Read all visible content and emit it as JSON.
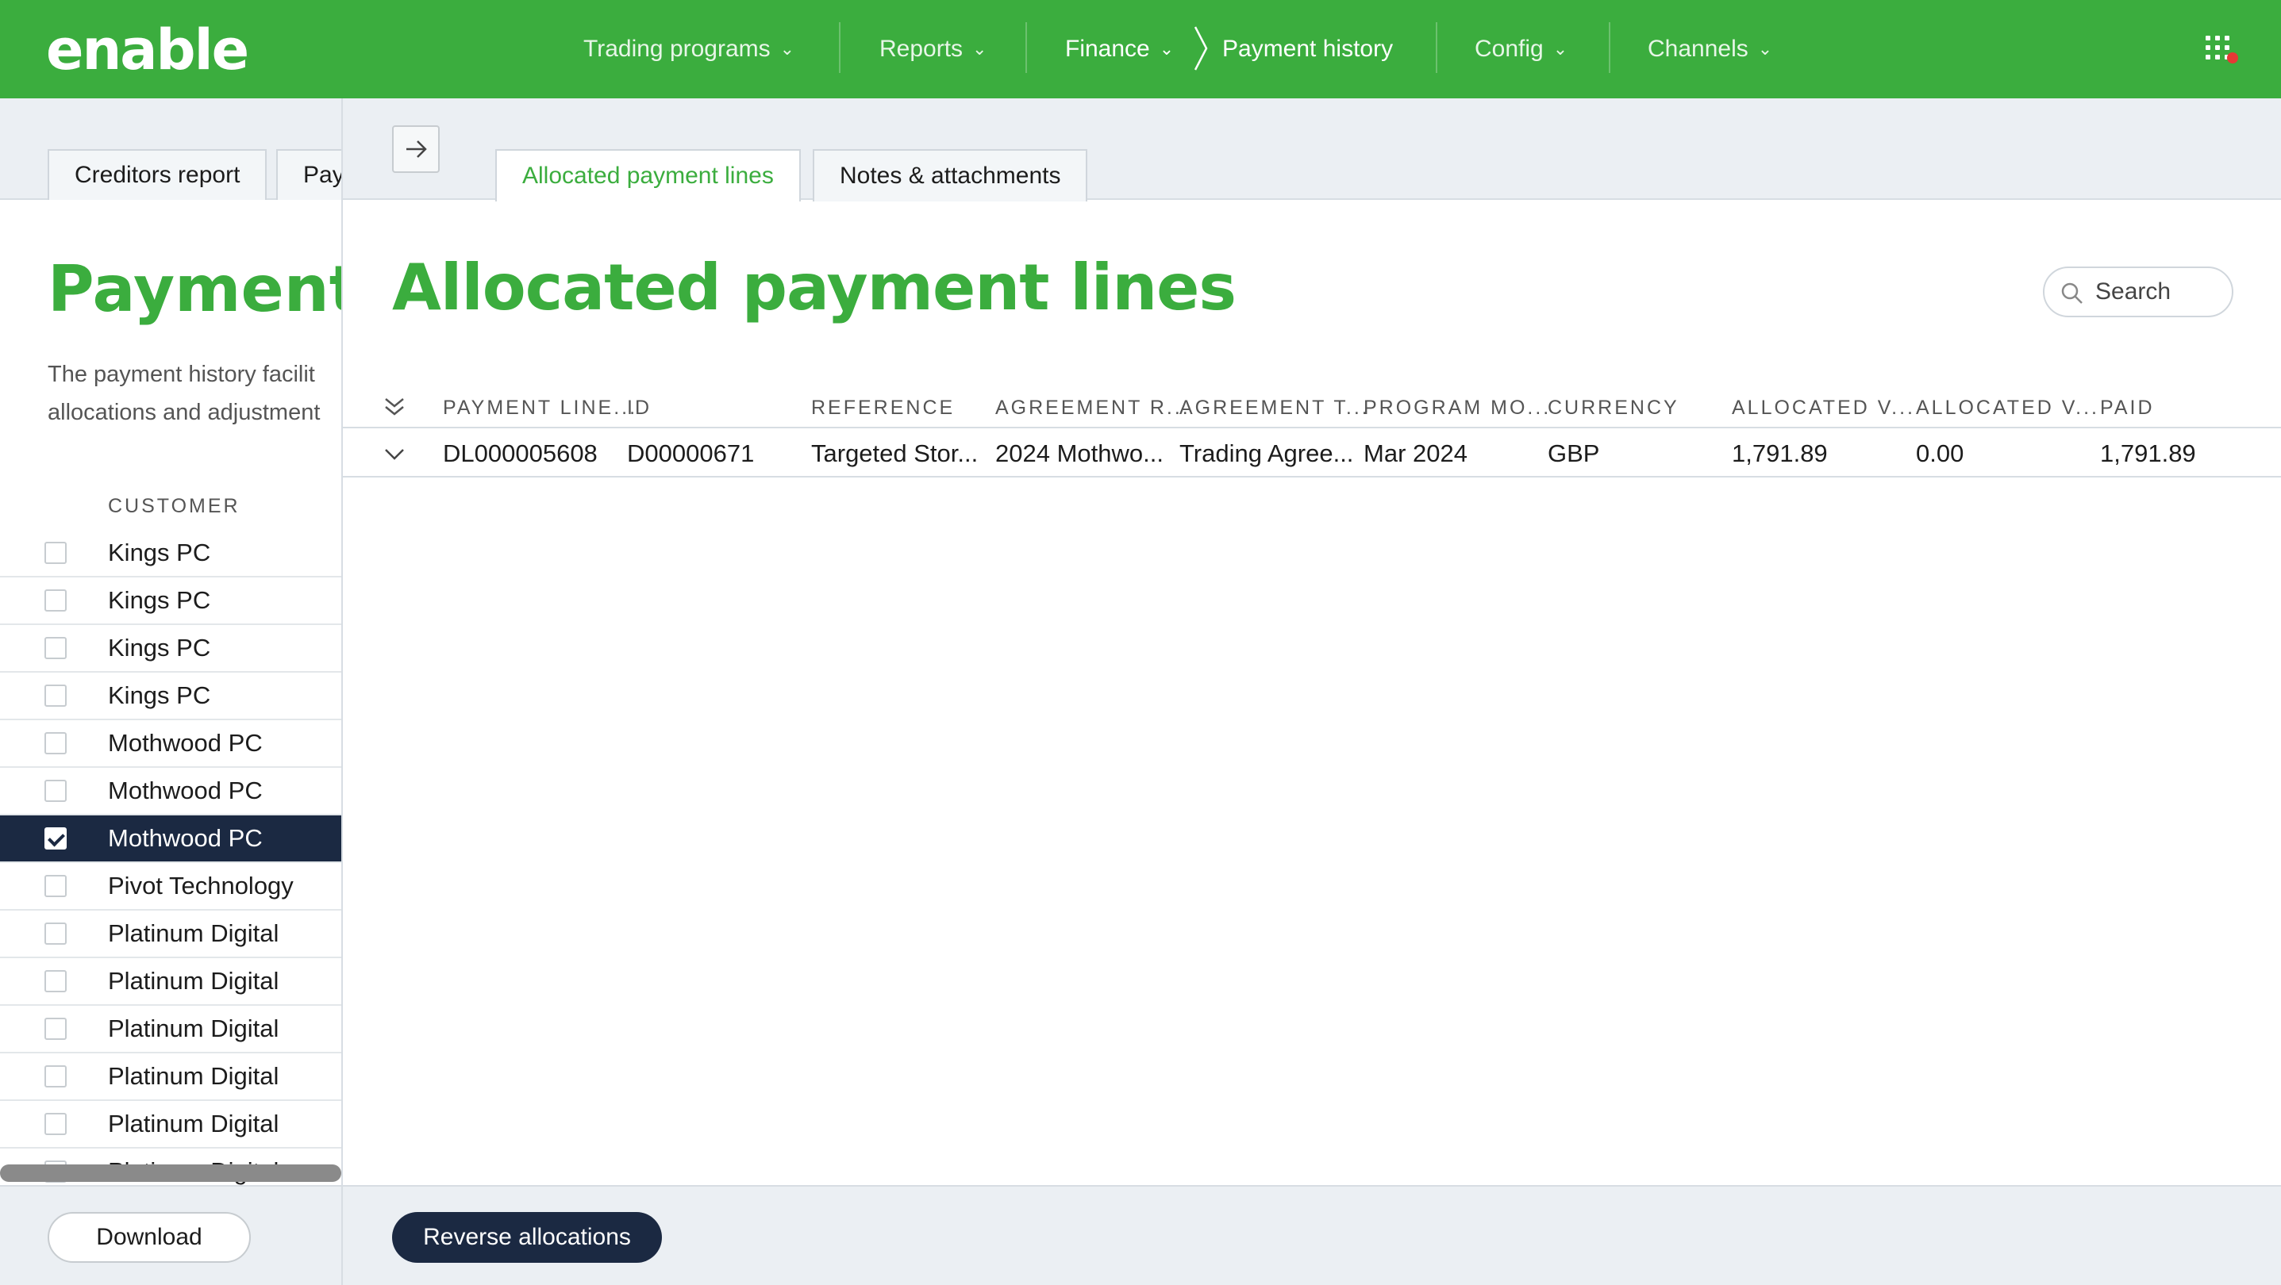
{
  "app": {
    "logo_text": "enable",
    "brand_color": "#3bad3e",
    "dark_color": "#1b2942"
  },
  "nav": {
    "trading_programs": "Trading programs",
    "reports": "Reports",
    "finance": "Finance",
    "payment_history": "Payment history",
    "config": "Config",
    "channels": "Channels",
    "apps_icon": "grid-icon"
  },
  "left": {
    "tabs": [
      "Creditors report",
      "Pay"
    ],
    "title": "Payment",
    "description_line1": "The payment history facilit",
    "description_line2": "allocations and adjustment",
    "column_header": "CUSTOMER",
    "customers": [
      {
        "name": "Kings PC",
        "checked": false
      },
      {
        "name": "Kings PC",
        "checked": false
      },
      {
        "name": "Kings PC",
        "checked": false
      },
      {
        "name": "Kings PC",
        "checked": false
      },
      {
        "name": "Mothwood PC",
        "checked": false
      },
      {
        "name": "Mothwood PC",
        "checked": false
      },
      {
        "name": "Mothwood PC",
        "checked": true
      },
      {
        "name": "Pivot Technology",
        "checked": false
      },
      {
        "name": "Platinum Digital",
        "checked": false
      },
      {
        "name": "Platinum Digital",
        "checked": false
      },
      {
        "name": "Platinum Digital",
        "checked": false
      },
      {
        "name": "Platinum Digital",
        "checked": false
      },
      {
        "name": "Platinum Digital",
        "checked": false
      },
      {
        "name": "Platinum Digital",
        "checked": false
      }
    ],
    "download_label": "Download"
  },
  "main": {
    "tabs": [
      "Allocated payment lines",
      "Notes & attachments"
    ],
    "active_tab": "Allocated payment lines",
    "title": "Allocated payment lines",
    "search_placeholder": "Search",
    "columns": [
      "PAYMENT LINE...",
      "ID",
      "REFERENCE",
      "AGREEMENT R...",
      "AGREEMENT T...",
      "PROGRAM MO...",
      "CURRENCY",
      "ALLOCATED V...",
      "ALLOCATED V...",
      "PAID"
    ],
    "rows": [
      [
        "DL000005608",
        "D00000671",
        "Targeted Stor...",
        "2024 Mothwo...",
        "Trading Agree...",
        "Mar 2024",
        "GBP",
        "1,791.89",
        "0.00",
        "1,791.89"
      ]
    ],
    "reverse_label": "Reverse allocations"
  }
}
